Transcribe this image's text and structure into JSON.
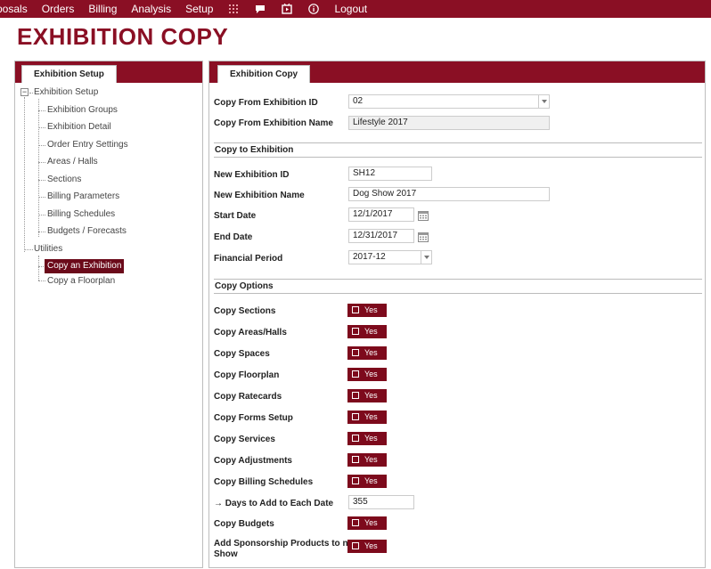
{
  "nav": {
    "items": [
      "posals",
      "Orders",
      "Billing",
      "Analysis",
      "Setup"
    ],
    "logout": "Logout",
    "icons": [
      "grid-icon",
      "chat-icon",
      "media-icon",
      "info-icon"
    ]
  },
  "page": {
    "title": "EXHIBITION COPY"
  },
  "left": {
    "tab": "Exhibition Setup",
    "root": "Exhibition Setup",
    "children": [
      "Exhibition Groups",
      "Exhibition Detail",
      "Order Entry Settings",
      "Areas / Halls",
      "Sections",
      "Billing Parameters",
      "Billing Schedules",
      "Budgets / Forecasts"
    ],
    "utilities": "Utilities",
    "utility_children": [
      "Copy an Exhibition",
      "Copy a Floorplan"
    ]
  },
  "right": {
    "tab": "Exhibition Copy",
    "copy_from_id_label": "Copy From Exhibition ID",
    "copy_from_id_value": "02",
    "copy_from_name_label": "Copy From Exhibition Name",
    "copy_from_name_value": "Lifestyle 2017",
    "section_copy_to": "Copy to Exhibition",
    "new_id_label": "New Exhibition ID",
    "new_id_value": "SH12",
    "new_name_label": "New Exhibition Name",
    "new_name_value": "Dog Show 2017",
    "start_date_label": "Start Date",
    "start_date_value": "12/1/2017",
    "end_date_label": "End Date",
    "end_date_value": "12/31/2017",
    "fin_period_label": "Financial Period",
    "fin_period_value": "2017-12",
    "section_options": "Copy Options",
    "options": [
      {
        "label": "Copy Sections",
        "value": "Yes"
      },
      {
        "label": "Copy Areas/Halls",
        "value": "Yes"
      },
      {
        "label": "Copy Spaces",
        "value": "Yes"
      },
      {
        "label": "Copy Floorplan",
        "value": "Yes"
      },
      {
        "label": "Copy Ratecards",
        "value": "Yes"
      },
      {
        "label": "Copy Forms Setup",
        "value": "Yes"
      },
      {
        "label": "Copy Services",
        "value": "Yes"
      },
      {
        "label": "Copy Adjustments",
        "value": "Yes"
      },
      {
        "label": "Copy Billing Schedules",
        "value": "Yes"
      }
    ],
    "days_label": "→ Days to Add to Each Date",
    "days_value": "355",
    "budgets_label": "Copy Budgets",
    "budgets_value": "Yes",
    "sponsorship_label_1": "Add Sponsorship Products to new",
    "sponsorship_label_2": "Show",
    "sponsorship_value": "Yes"
  },
  "colors": {
    "brand": "#8a0f24",
    "toggle": "#7d0a1c"
  }
}
